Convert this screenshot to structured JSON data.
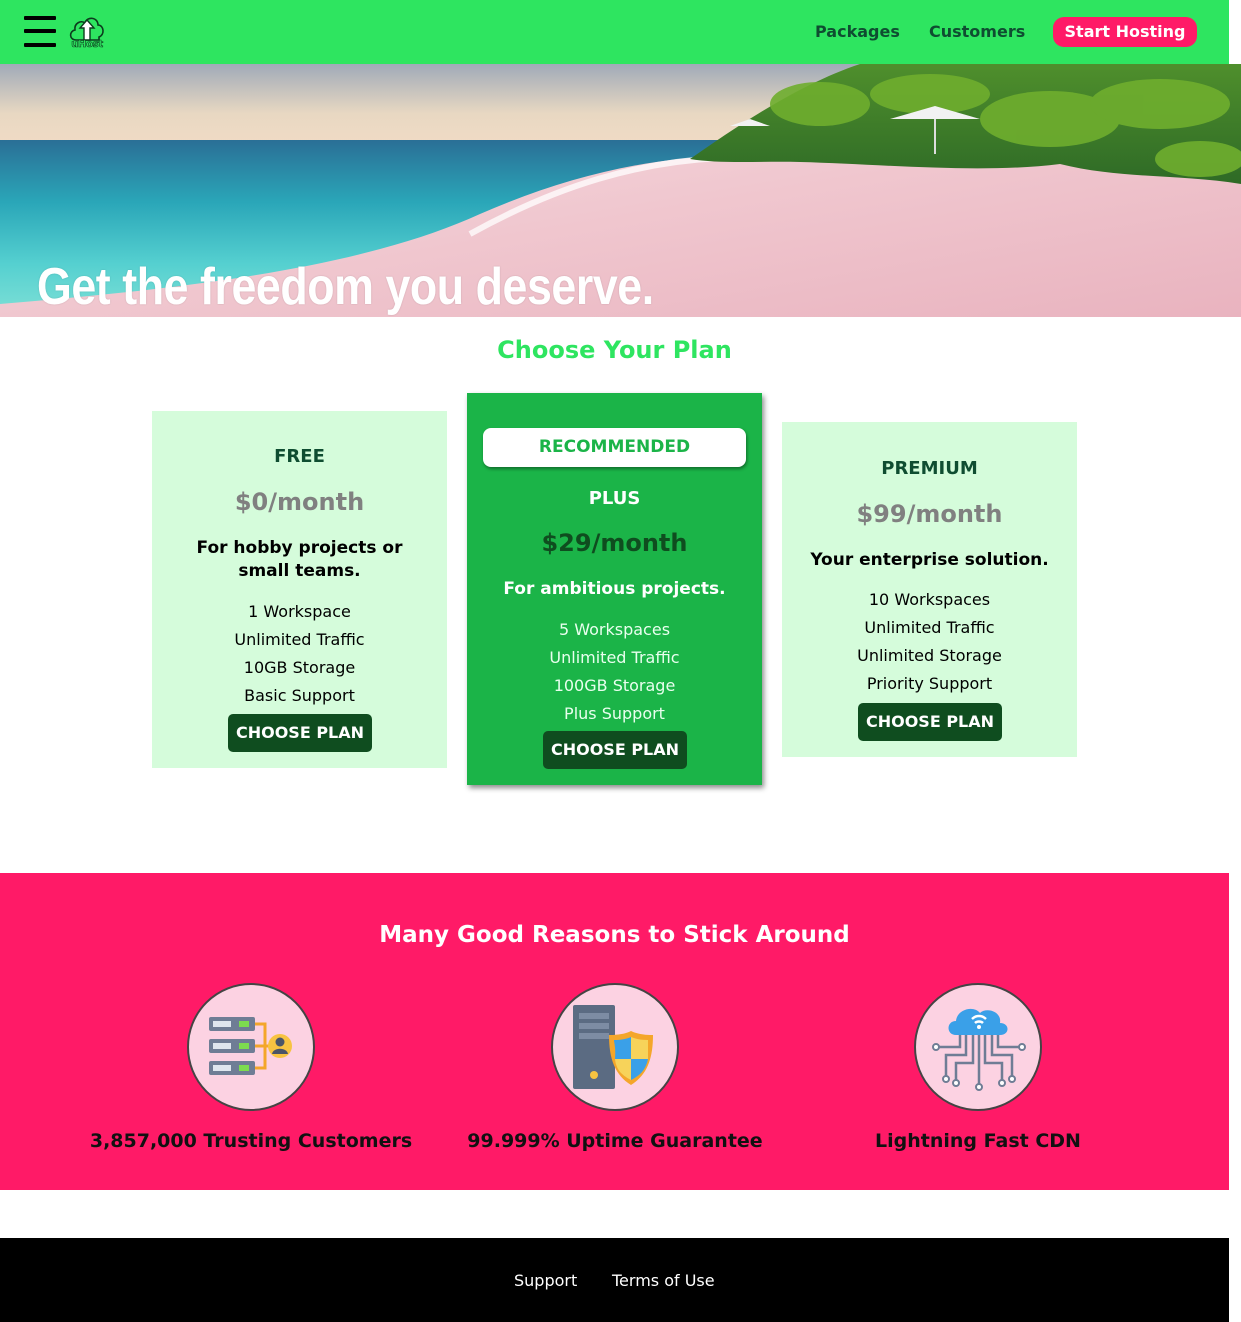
{
  "header": {
    "logo_text": "uHost",
    "nav": {
      "packages": "Packages",
      "customers": "Customers",
      "start_hosting": "Start Hosting"
    },
    "colors": {
      "bar": "#2ee560",
      "cta": "#ff1a67"
    }
  },
  "hero": {
    "title": "Get the freedom you deserve.",
    "image": "tropical-beach-photo"
  },
  "plans": {
    "heading": "Choose Your Plan",
    "items": [
      {
        "name": "FREE",
        "price": "$0/month",
        "tagline": "For hobby projects or small teams.",
        "features": [
          "1 Workspace",
          "Unlimited Traffic",
          "10GB Storage",
          "Basic Support"
        ],
        "button": "CHOOSE PLAN"
      },
      {
        "badge": "RECOMMENDED",
        "name": "PLUS",
        "price": "$29/month",
        "tagline": "For ambitious projects.",
        "features": [
          "5 Workspaces",
          "Unlimited Traffic",
          "100GB Storage",
          "Plus Support"
        ],
        "button": "CHOOSE PLAN"
      },
      {
        "name": "PREMIUM",
        "price": "$99/month",
        "tagline": "Your enterprise solution.",
        "features": [
          "10 Workspaces",
          "Unlimited Traffic",
          "Unlimited Storage",
          "Priority Support"
        ],
        "button": "CHOOSE PLAN"
      }
    ]
  },
  "reasons": {
    "heading": "Many Good Reasons to Stick Around",
    "items": [
      {
        "icon": "server-user-icon",
        "label": "3,857,000 Trusting Customers"
      },
      {
        "icon": "server-shield-icon",
        "label": "99.999% Uptime Guarantee"
      },
      {
        "icon": "cloud-network-icon",
        "label": "Lightning Fast CDN"
      }
    ]
  },
  "footer": {
    "support": "Support",
    "terms": "Terms of Use"
  }
}
